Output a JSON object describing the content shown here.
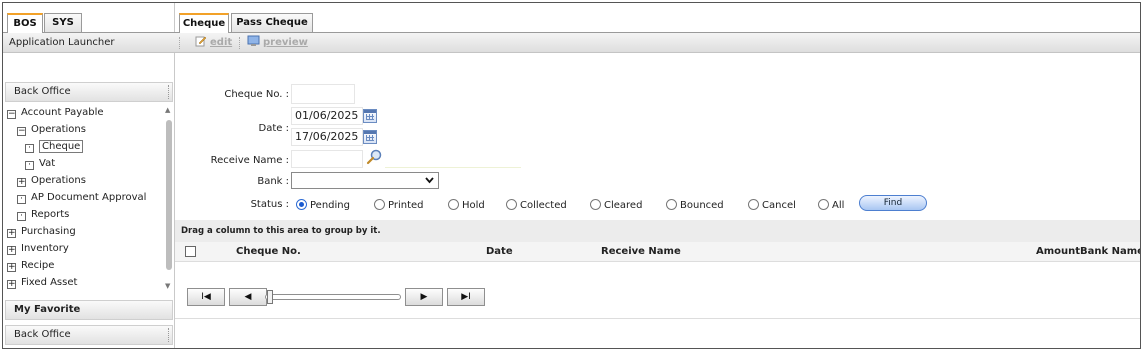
{
  "left_panel": {
    "tabs": [
      {
        "label": "BOS",
        "active": true
      },
      {
        "label": "SYS",
        "active": false
      }
    ],
    "app_launcher": "Application Launcher",
    "accordion": {
      "top_header": "Back Office",
      "favorite_header": "My Favorite",
      "bottom_header": "Back Office"
    },
    "tree": [
      {
        "label": "Account Payable",
        "expander": "−"
      },
      {
        "label": "Operations",
        "expander": "−"
      },
      {
        "label": "Cheque",
        "expander": "·"
      },
      {
        "label": "Vat",
        "expander": "·"
      },
      {
        "label": "Operations",
        "expander": "+"
      },
      {
        "label": "AP Document Approval",
        "expander": "·"
      },
      {
        "label": "Reports",
        "expander": "·"
      },
      {
        "label": "Purchasing",
        "expander": "+"
      },
      {
        "label": "Inventory",
        "expander": "+"
      },
      {
        "label": "Recipe",
        "expander": "+"
      },
      {
        "label": "Fixed Asset",
        "expander": "+"
      }
    ]
  },
  "right_panel": {
    "tabs": [
      {
        "label": "Cheque",
        "active": true
      },
      {
        "label": "Pass Cheque",
        "active": false
      }
    ],
    "toolbar": {
      "edit": "edit",
      "preview": "preview"
    },
    "form": {
      "cheque_no_label": "Cheque No. :",
      "cheque_no_value": "",
      "date_label": "Date :",
      "date_from": "01/06/2025",
      "date_to": "17/06/2025",
      "receive_name_label": "Receive Name :",
      "receive_name_value": "",
      "bank_label": "Bank :",
      "bank_value": "",
      "status_label": "Status :",
      "statuses": [
        {
          "label": "Pending",
          "selected": true
        },
        {
          "label": "Printed",
          "selected": false
        },
        {
          "label": "Hold",
          "selected": false
        },
        {
          "label": "Collected",
          "selected": false
        },
        {
          "label": "Cleared",
          "selected": false
        },
        {
          "label": "Bounced",
          "selected": false
        },
        {
          "label": "Cancel",
          "selected": false
        },
        {
          "label": "All",
          "selected": false
        }
      ],
      "find_button": "Find"
    },
    "grid": {
      "group_hint": "Drag a column to this area to group by it.",
      "columns": [
        "Cheque No.",
        "Date",
        "Receive Name",
        "Amount",
        "Bank Name"
      ]
    },
    "pager": {
      "first": "I◀",
      "prev": "◀",
      "next": "▶",
      "last": "▶I"
    }
  },
  "colors": {
    "active_tab_accent": "#f2a128",
    "link_disabled": "#aaaaaa",
    "button_border": "#4d7fd0"
  }
}
